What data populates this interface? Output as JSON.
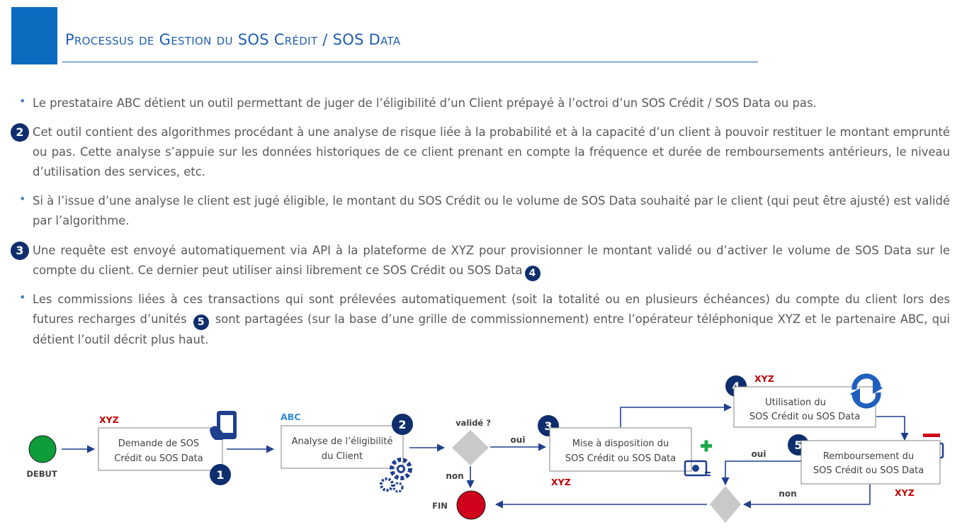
{
  "header": {
    "title": "Processus de Gestion du SOS Crédit / SOS Data",
    "accent_color": "#0b6bbf"
  },
  "paragraphs": [
    {
      "marker": "bullet",
      "text": "Le prestataire ABC détient un outil permettant de juger de l’éligibilité d’un Client prépayé à l’octroi d’un SOS Crédit / SOS Data ou pas."
    },
    {
      "marker": "2",
      "text": "Cet outil contient des algorithmes procédant à une analyse de risque liée à la probabilité et à la capacité d’un client à pouvoir restituer le montant emprunté ou pas. Cette analyse s’appuie sur les données historiques de ce client prenant en compte la fréquence et durée de remboursements antérieurs, le niveau d’utilisation des services, etc."
    },
    {
      "marker": "bullet",
      "text": "Si à l’issue d’une analyse le client est jugé éligible, le montant du SOS Crédit ou le volume de SOS Data souhaité par le client (qui peut être ajusté) est validé par l’algorithme."
    },
    {
      "marker": "3",
      "text": "Une requête est envoyé automatiquement via API à la plateforme de XYZ pour provisionner le montant validé ou d’activer le volume de SOS Data sur le compte du client. Ce dernier peut utiliser ainsi librement ce SOS Crédit ou SOS Data",
      "inline_badge": "4"
    },
    {
      "marker": "bullet",
      "text_before": "Les commissions liées à ces transactions qui sont prélevées automatiquement (soit la totalité ou en plusieurs échéances) du compte du client lors des futures recharges d’unités",
      "inline_badge": "5",
      "text_after": "sont partagées (sur la base d’une grille de commissionnement) entre l’opérateur téléphonique XYZ et le partenaire ABC, qui détient l’outil décrit plus haut."
    }
  ],
  "diagram": {
    "start": {
      "label": "DEBUT",
      "color": "#0f9d3a"
    },
    "end": {
      "label": "FIN",
      "color": "#d0021b"
    },
    "steps": [
      {
        "id": "demande",
        "actor": "XYZ",
        "actor_color": "#c00000",
        "badge": "1",
        "lines": [
          "Demande de SOS",
          "Crédit ou SOS Data"
        ],
        "icon": "phone-hand-icon"
      },
      {
        "id": "analyse",
        "actor": "ABC",
        "actor_color": "#2e8bd6",
        "badge": "2",
        "lines": [
          "Analyse de l’éligibilité",
          "du Client"
        ],
        "icon": "gears-icon"
      },
      {
        "id": "mise",
        "actor": "XYZ",
        "actor_color": "#c00000",
        "badge": "3",
        "lines": [
          "Mise à disposition du",
          "SOS Crédit ou SOS Data"
        ],
        "icon": "money-plus-icon"
      },
      {
        "id": "utilisation",
        "actor": "XYZ",
        "actor_color": "#c00000",
        "badge": "4",
        "lines": [
          "Utilisation du",
          "SOS Crédit ou SOS Data"
        ],
        "icon": "refresh-icon"
      },
      {
        "id": "remboursement",
        "actor": "XYZ",
        "actor_color": "#c00000",
        "badge": "5",
        "lines": [
          "Remboursement du",
          "SOS Crédit ou SOS Data"
        ],
        "icon": "money-minus-icon"
      }
    ],
    "decisions": [
      {
        "id": "valide",
        "question": "validé ?",
        "yes": "oui",
        "no": "non"
      },
      {
        "id": "rembourse",
        "yes": "oui",
        "no": "non"
      }
    ],
    "colors": {
      "line": "#1f3f8f",
      "box_border": "#808080",
      "badge": "#0e2e6e",
      "decision": "#c9c9c9"
    }
  }
}
